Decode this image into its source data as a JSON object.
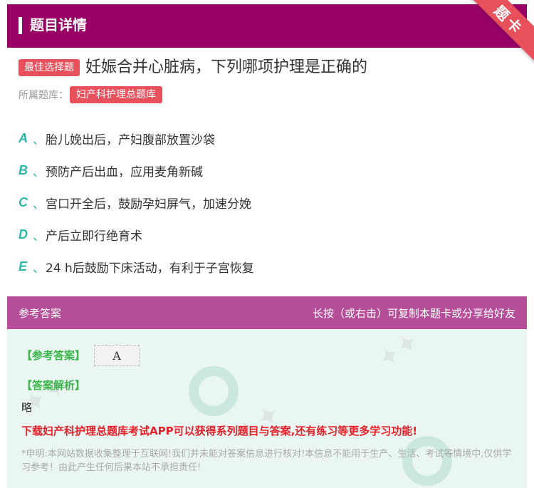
{
  "header": {
    "title": "题目详情",
    "corner_ribbon": "题卡"
  },
  "question": {
    "type_badge": "最佳选择题",
    "text": "妊娠合并心脏病，下列哪项护理是正确的",
    "bank_label": "所属题库：",
    "bank_name": "妇产科护理总题库"
  },
  "options": [
    {
      "letter": "A",
      "sep": "、",
      "text": "胎儿娩出后，产妇腹部放置沙袋"
    },
    {
      "letter": "B",
      "sep": "、",
      "text": "预防产后出血，应用麦角新碱"
    },
    {
      "letter": "C",
      "sep": "、",
      "text": "宫口开全后，鼓励孕妇屏气，加速分娩"
    },
    {
      "letter": "D",
      "sep": "、",
      "text": "产后立即行绝育术"
    },
    {
      "letter": "E",
      "sep": "、",
      "text": "24 h后鼓励下床活动，有利于子宫恢复"
    }
  ],
  "answer_bar": {
    "left": "参考答案",
    "right": "长按（或右击）可复制本题卡或分享给好友"
  },
  "answer": {
    "answer_label": "【参考答案】",
    "answer_value": "A",
    "explanation_label": "【答案解析】",
    "explanation_text": "略",
    "promo": "下载妇产科护理总题库考试APP可以获得系列题目与答案,还有练习等更多学习功能!",
    "disclaimer": "*申明:本网站数据收集整理于互联网!我们并未能对答案信息进行核对!本信息不能用于生产、生活、考试等情境中,仅供学习参考！由此产生任何后果本站不承担责任!"
  },
  "colors": {
    "header": "#990066",
    "answer_bar": "#b64d98",
    "badge": "#e8505b",
    "option_letter": "#2bb8a8",
    "answer_label": "#3ab54a",
    "promo": "#e8202a",
    "answer_panel": "#eaf6f2"
  }
}
